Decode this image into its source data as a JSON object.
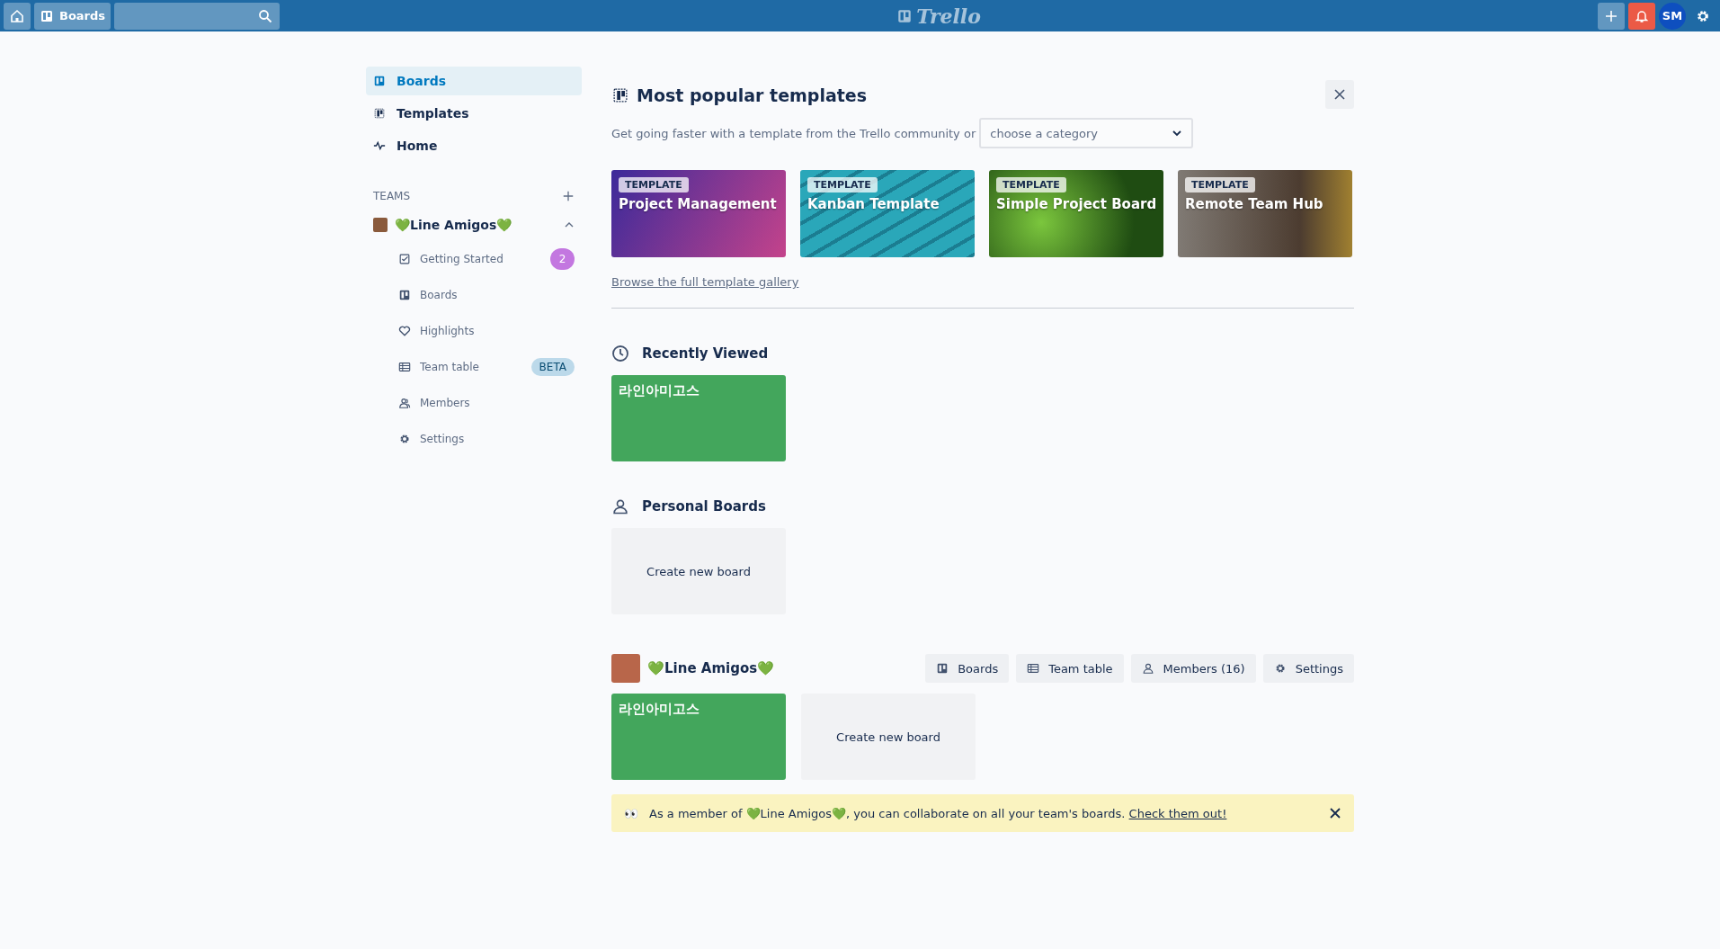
{
  "top_bar": {
    "boards_button": "Boards",
    "logo": "Trello",
    "avatar": "SM"
  },
  "sidebar": {
    "nav": [
      {
        "label": "Boards",
        "kind": "board",
        "selected": true
      },
      {
        "label": "Templates",
        "kind": "template",
        "selected": false
      },
      {
        "label": "Home",
        "kind": "pulse",
        "selected": false
      }
    ],
    "teams_heading": "TEAMS",
    "team": {
      "name": "💚Line Amigos💚",
      "expanded": true,
      "items": [
        {
          "label": "Getting Started",
          "kind": "check",
          "badge": {
            "kind": "count",
            "text": "2"
          }
        },
        {
          "label": "Boards",
          "kind": "board"
        },
        {
          "label": "Highlights",
          "kind": "heart"
        },
        {
          "label": "Team table",
          "kind": "table",
          "badge": {
            "kind": "beta",
            "text": "BETA"
          }
        },
        {
          "label": "Members",
          "kind": "people"
        },
        {
          "label": "Settings",
          "kind": "gear"
        }
      ]
    }
  },
  "templates": {
    "title": "Most popular templates",
    "subtitle": "Get going faster with a template from the Trello community or",
    "category": {
      "placeholder": "choose a category"
    },
    "cards": [
      {
        "tag": "TEMPLATE",
        "title": "Project Management",
        "kind": "purple"
      },
      {
        "tag": "TEMPLATE",
        "title": "Kanban Template",
        "kind": "teal"
      },
      {
        "tag": "TEMPLATE",
        "title": "Simple Project Board",
        "kind": "leaves"
      },
      {
        "tag": "TEMPLATE",
        "title": "Remote Team Hub",
        "kind": "train"
      }
    ],
    "link": "Browse the full template gallery"
  },
  "recently_viewed": {
    "title": "Recently Viewed",
    "boards": [
      {
        "title": "라인아미고스"
      }
    ]
  },
  "personal_boards": {
    "title": "Personal Boards",
    "create": "Create new board"
  },
  "team_section": {
    "name": "💚Line Amigos💚",
    "buttons": [
      {
        "label": "Boards",
        "kind": "board"
      },
      {
        "label": "Team table",
        "kind": "table"
      },
      {
        "label": "Members (16)",
        "kind": "person"
      },
      {
        "label": "Settings",
        "kind": "gear"
      }
    ],
    "boards": [
      {
        "title": "라인아미고스"
      }
    ],
    "create": "Create new board"
  },
  "banner": {
    "emoji": "👀",
    "text": "As a member of 💚Line Amigos💚, you can collaborate on all your team's boards.",
    "link": "Check them out!"
  }
}
